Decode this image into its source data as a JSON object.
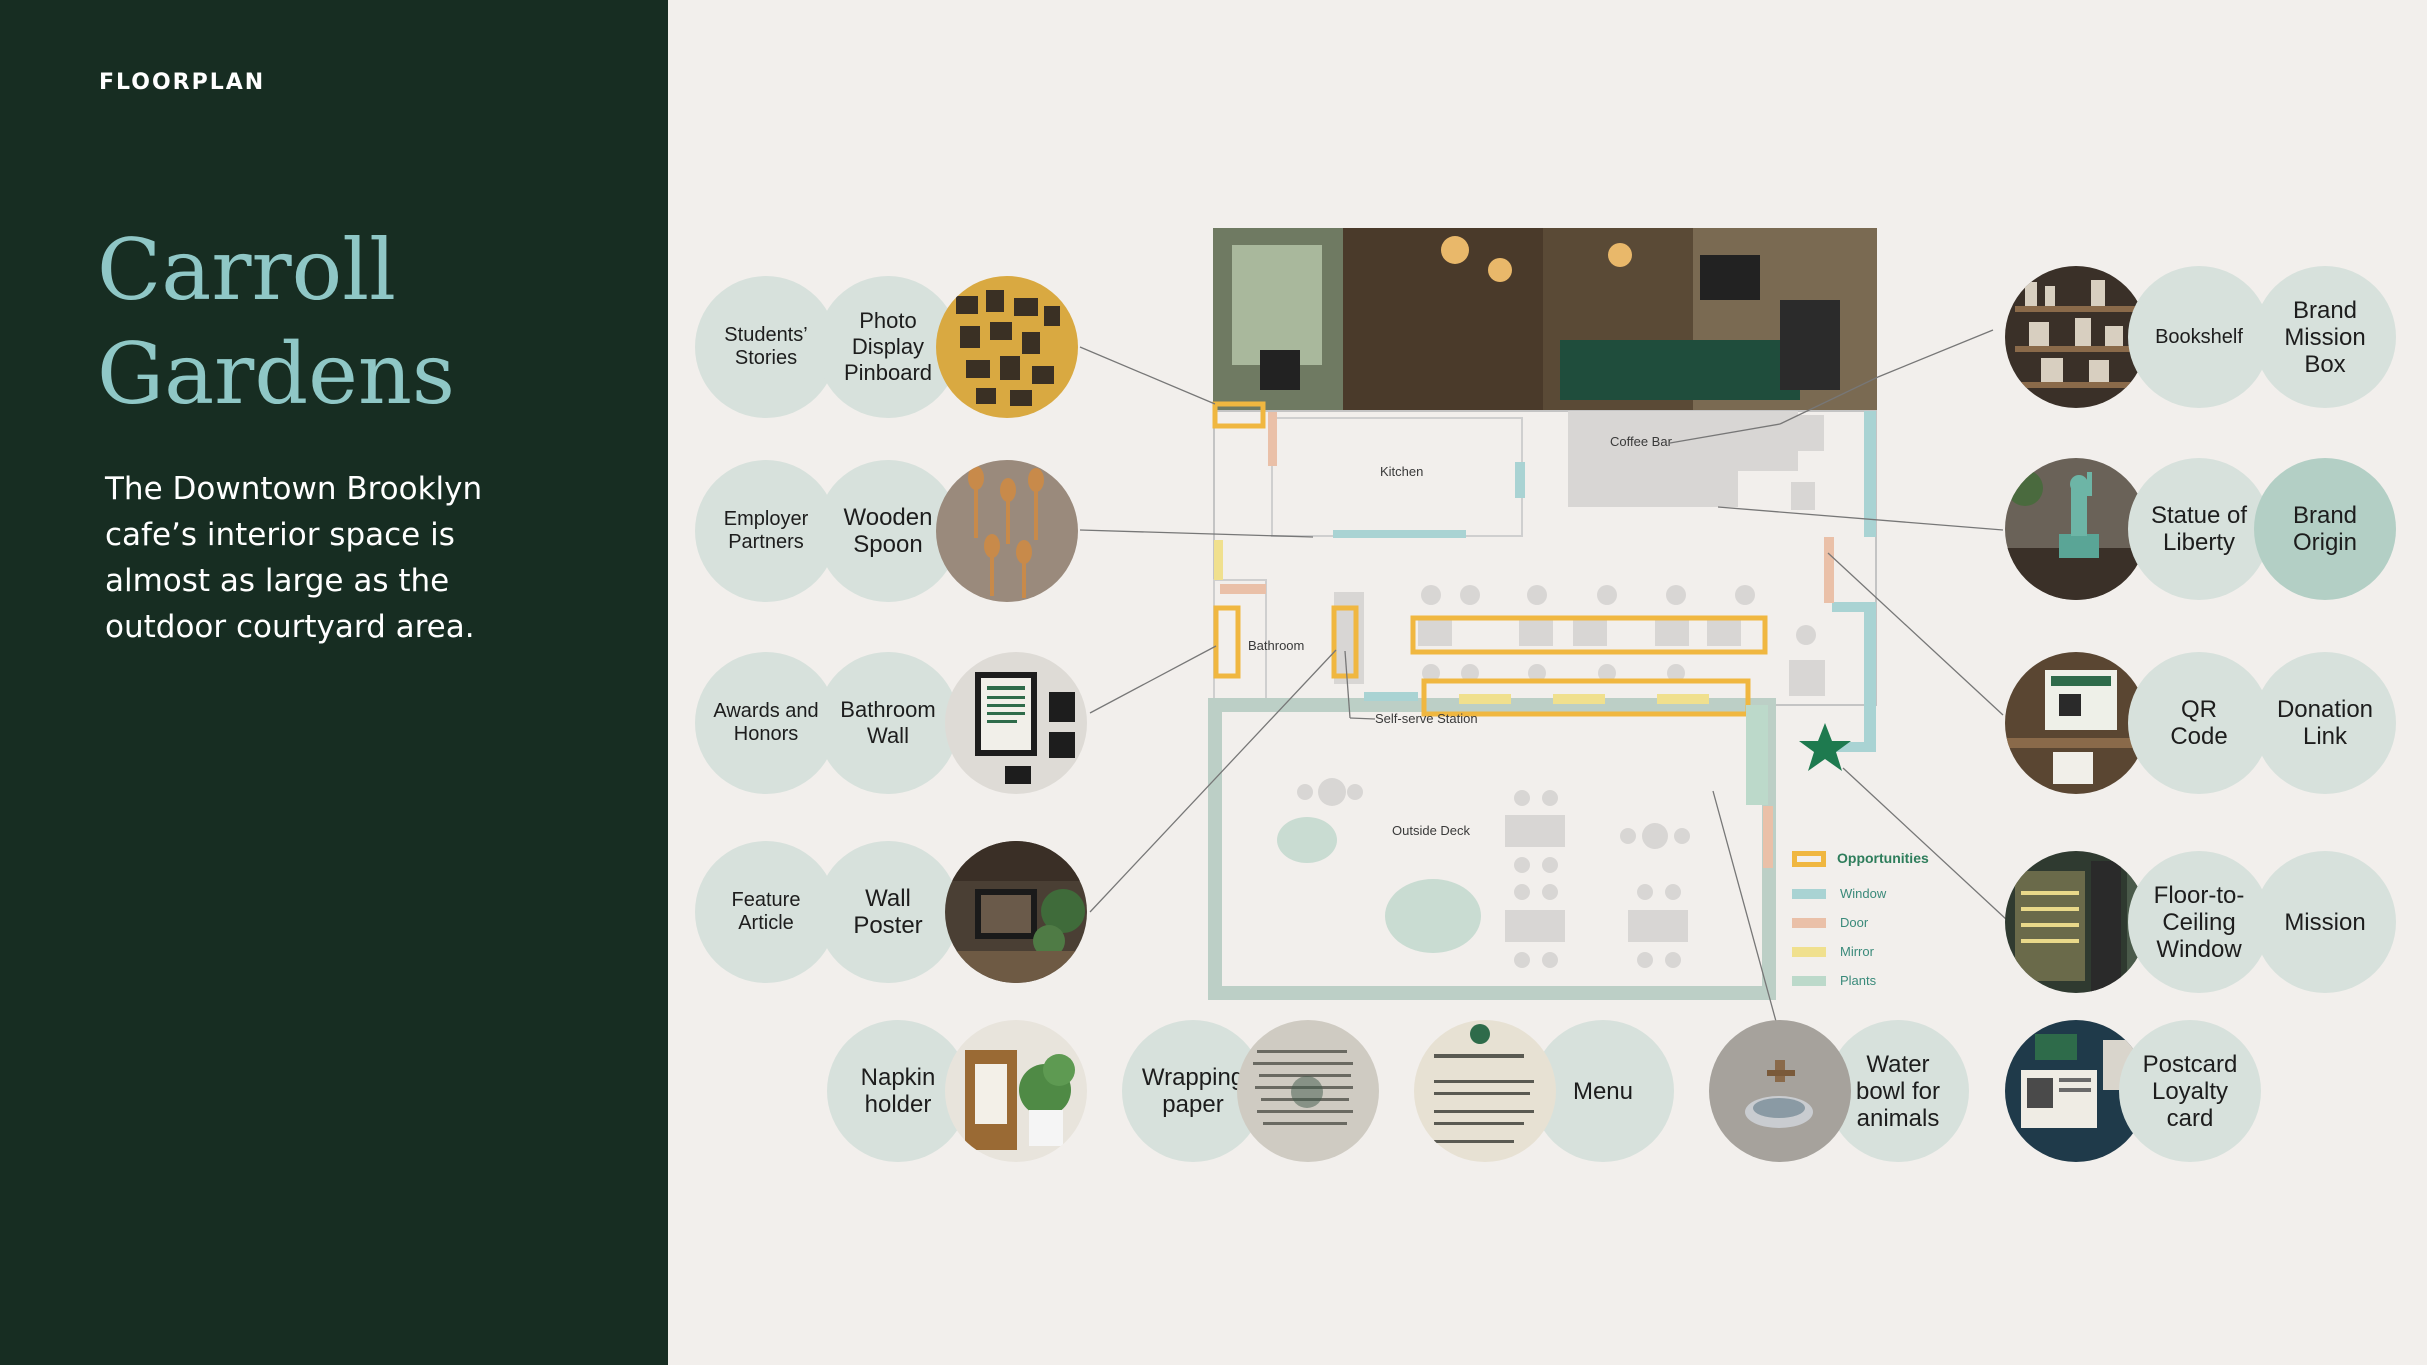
{
  "sidebar": {
    "eyebrow": "FLOORPLAN",
    "title_line1": "Carroll",
    "title_line2": "Gardens",
    "description": "The Downtown Brooklyn cafe’s interior space is almost as large as the outdoor courtyard area."
  },
  "left_rows": [
    {
      "category": "Students’\nStories",
      "item": "Photo\nDisplay\nPinboard",
      "photo": "pinboard-photo"
    },
    {
      "category": "Employer\nPartners",
      "item": "Wooden\nSpoon",
      "photo": "spoons-photo"
    },
    {
      "category": "Awards and\nHonors",
      "item": "Bathroom\nWall",
      "photo": "bathroom-wall-photo"
    },
    {
      "category": "Feature\nArticle",
      "item": "Wall\nPoster",
      "photo": "wall-poster-photo"
    }
  ],
  "right_rows": [
    {
      "item": "Bookshelf",
      "category": "Brand\nMission\nBox",
      "photo": "bookshelf-photo"
    },
    {
      "item": "Statue of\nLiberty",
      "category": "Brand\nOrigin",
      "photo": "statue-photo"
    },
    {
      "item": "QR\nCode",
      "category": "Donation\nLink",
      "photo": "qr-photo"
    },
    {
      "item": "Floor-to-\nCeiling\nWindow",
      "category": "Mission",
      "photo": "window-photo"
    },
    {
      "item": "Postcard\nLoyalty\ncard",
      "photo": "postcard-photo"
    }
  ],
  "bottom_row": [
    {
      "item": "Napkin\nholder",
      "photo": "napkin-photo"
    },
    {
      "item": "Wrapping\npaper",
      "photo": "wrapping-photo"
    },
    {
      "item": "Menu",
      "photo": "menu-photo"
    },
    {
      "item": "Water\nbowl for\nanimals",
      "photo": "water-bowl-photo"
    }
  ],
  "floorplan": {
    "labels": {
      "coffee_bar": "Coffee Bar",
      "kitchen": "Kitchen",
      "bathroom": "Bathroom",
      "self_serve": "Self-serve Station",
      "outside_deck": "Outside Deck"
    },
    "legend": {
      "title": "Opportunities",
      "items": [
        {
          "label": "Window",
          "color": "#a9d3d3"
        },
        {
          "label": "Door",
          "color": "#eac0a8"
        },
        {
          "label": "Mirror",
          "color": "#f0e08e"
        },
        {
          "label": "Plants",
          "color": "#bcd9ca"
        }
      ]
    },
    "colors": {
      "opportunity": "#f0b740",
      "window": "#a9d3d3",
      "door": "#eac0a8",
      "mirror": "#f0e08e",
      "plants": "#bcd9ca",
      "star": "#1e7a4f"
    }
  }
}
